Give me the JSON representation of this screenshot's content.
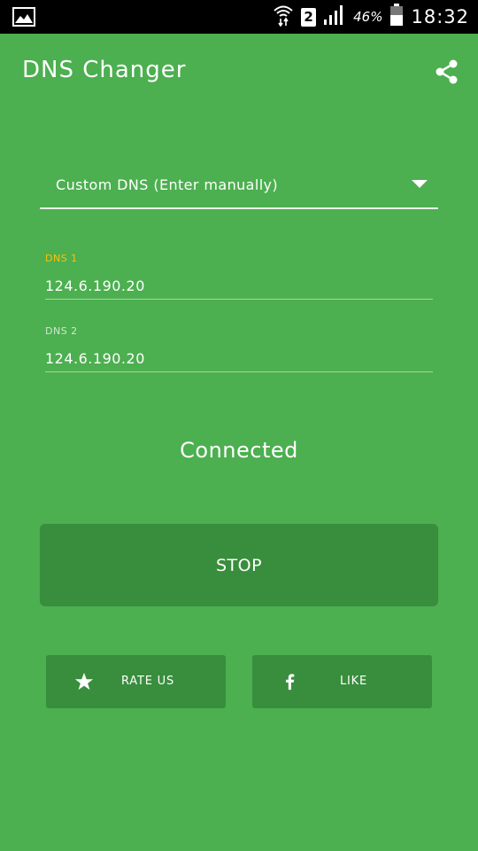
{
  "status_bar": {
    "battery_percent": "46%",
    "time": "18:32",
    "sim_slot": "2"
  },
  "app_bar": {
    "title": "DNS Changer",
    "share_icon": "share-icon"
  },
  "dns_selector": {
    "selected": "Custom DNS (Enter manually)"
  },
  "fields": {
    "dns1": {
      "label": "DNS 1",
      "value": "124.6.190.20"
    },
    "dns2": {
      "label": "DNS 2",
      "value": "124.6.190.20"
    }
  },
  "status": {
    "text": "Connected"
  },
  "buttons": {
    "stop": "STOP",
    "rate": "RATE US",
    "like": "LIKE"
  },
  "colors": {
    "background": "#4caf50",
    "button": "#388e3c",
    "focus_label": "#ffc107"
  }
}
